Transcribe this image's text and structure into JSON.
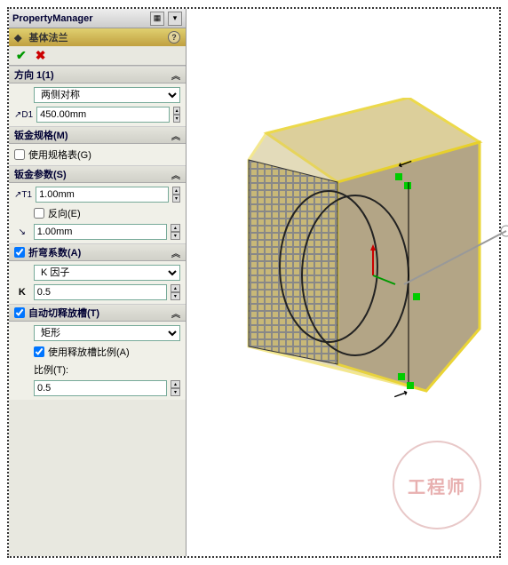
{
  "header": {
    "title": "PropertyManager"
  },
  "feature": {
    "name": "基体法兰"
  },
  "direction": {
    "header": "方向 1(1)",
    "end_condition": "两侧对称",
    "depth": "450.00mm"
  },
  "gauge": {
    "header": "钣金规格(M)",
    "use_table": "使用规格表(G)"
  },
  "params": {
    "header": "钣金参数(S)",
    "thickness": "1.00mm",
    "reverse": "反向(E)",
    "radius": "1.00mm"
  },
  "bend": {
    "header": "折弯系数(A)",
    "type": "K 因子",
    "k_label": "K",
    "k_value": "0.5"
  },
  "relief": {
    "header": "自动切释放槽(T)",
    "type": "矩形",
    "use_ratio": "使用释放槽比例(A)",
    "ratio_label": "比例(T):",
    "ratio": "0.5"
  },
  "watermark": "工程师"
}
